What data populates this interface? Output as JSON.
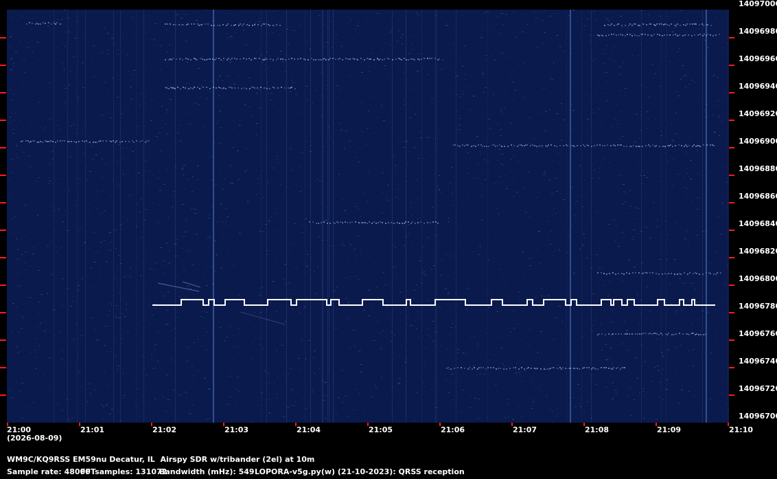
{
  "spectrogram": {
    "background_color": "#0b1a4d",
    "signal_color": "#ffffff",
    "tick_color": "#ff1a1a",
    "date": "(2026-08-09)",
    "time_labels": [
      "21:00",
      "21:01",
      "21:02",
      "21:03",
      "21:04",
      "21:05",
      "21:06",
      "21:07",
      "21:08",
      "21:09",
      "21:10"
    ],
    "frequency_labels": [
      "14097000",
      "14096980",
      "14096960",
      "14096940",
      "14096920",
      "14096900",
      "14096880",
      "14096860",
      "14096840",
      "14096820",
      "14096800",
      "14096780",
      "14096760",
      "14096740",
      "14096720",
      "14096700"
    ]
  },
  "footer": {
    "station_line": "WM9C/KQ9RSS EM59nu Decatur, IL  Airspy SDR w/tribander (2el) at 10m",
    "sample_rate": "Sample rate: 48000",
    "fft_samples": "FFTsamples: 131072",
    "bandwidth": "Bandwidth (mHz): 549",
    "software": "LOPORA-v5g.py(w) (21-10-2023): QRSS reception"
  }
}
